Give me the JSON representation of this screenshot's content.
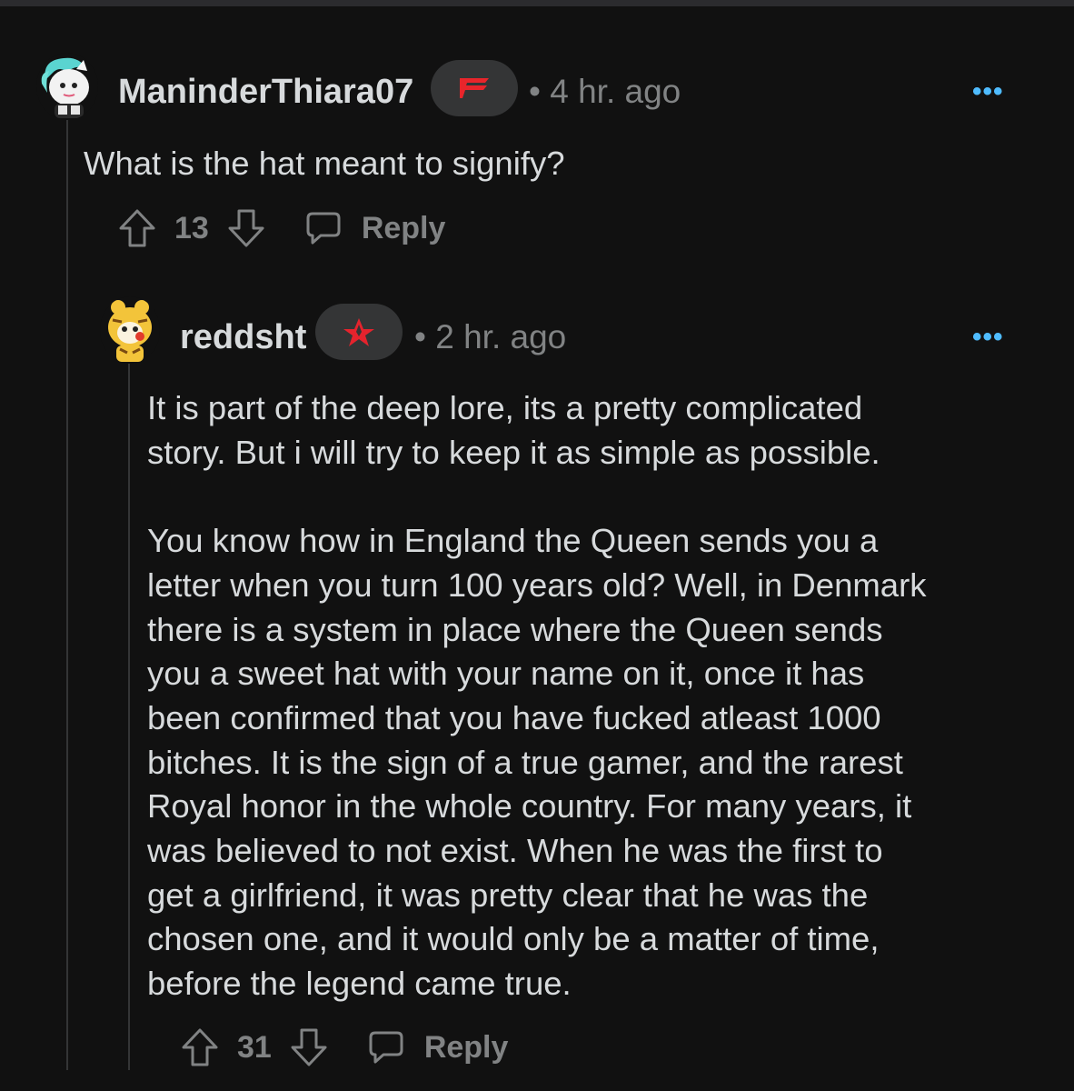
{
  "comments": [
    {
      "username": "ManinderThiara07",
      "flair": "faze-clan-flair",
      "timestamp": "• 4 hr. ago",
      "more": "•••",
      "body": [
        "What is the hat meant to signify?"
      ],
      "votes": "13",
      "reply_label": "Reply"
    },
    {
      "username": "reddsht",
      "flair": "astralis-flair",
      "timestamp": "• 2 hr. ago",
      "more": "•••",
      "body": [
        "It is part of the deep lore, its a pretty complicated",
        "story. But i will try to keep it as simple as possible.",
        "",
        "You know how in England the Queen sends you a",
        "letter when you turn 100 years old? Well, in Denmark",
        "there is a system in place where the Queen sends",
        "you a sweet hat with your name on it, once it has",
        "been confirmed that you have fucked atleast 1000",
        "bitches. It is the sign of a true gamer, and the rarest",
        "Royal honor in the whole country. For many years, it",
        "was believed to not exist. When he was the first to",
        "get a girlfriend, it was pretty clear that he was the",
        "chosen one, and it would only be a matter of time,",
        "before the legend came true."
      ],
      "votes": "31",
      "reply_label": "Reply"
    }
  ],
  "colors": {
    "background": "#111111",
    "text": "#d7dadc",
    "muted": "#818384",
    "accent": "#4fbcff",
    "flair_bg": "#343536",
    "faze_red": "#e8252b",
    "astralis_red": "#e5232d"
  },
  "icons": [
    "upvote-icon",
    "downvote-icon",
    "comment-icon",
    "overflow-menu-icon"
  ]
}
